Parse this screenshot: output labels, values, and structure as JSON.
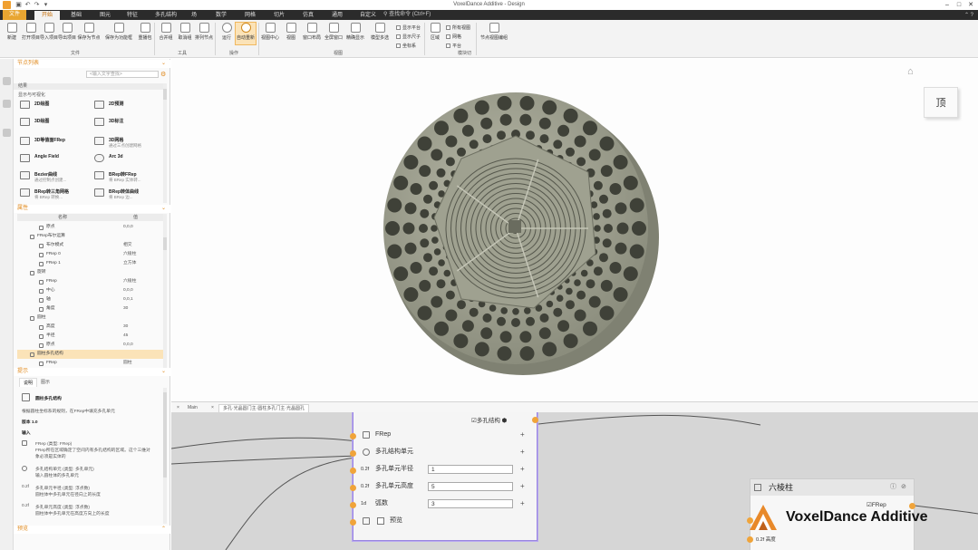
{
  "app": {
    "title": "VoxelDance Additive - Design"
  },
  "menu": {
    "file": "文件",
    "tabs": [
      "开始",
      "基础",
      "图元",
      "特征",
      "多孔结构",
      "场",
      "数学",
      "网格",
      "切片",
      "仿真",
      "通用",
      "自定义"
    ],
    "active_tab": "开始",
    "search_placeholder": "查找命令 (Ctrl+F)"
  },
  "ribbon": {
    "buttons": [
      "新建",
      "打开项目",
      "导入项目",
      "导出项目",
      "保存为节点",
      "保存为功能框",
      "重播包",
      "合并组",
      "取消组",
      "排列节点",
      "运行",
      "自动重新",
      "视图中心",
      "视图",
      "窗口布局",
      "全屏窗口",
      "精确显示",
      "模型多选",
      "区域"
    ],
    "checks": [
      "显示平台",
      "显示尺子",
      "坐标系"
    ],
    "right_checks": [
      "所有视图",
      "网格",
      "平台"
    ],
    "last_button": "节点视图编组",
    "groups": [
      "文件",
      "工具",
      "操作",
      "视图",
      "模块切"
    ]
  },
  "left_panel": {
    "header": "节点列表",
    "search_placeholder": "<输入文字查找>",
    "section_title": "结果",
    "subsection": "显示与可视化",
    "nodes": [
      {
        "name": "2D绘图",
        "desc": ""
      },
      {
        "name": "2D预测",
        "desc": ""
      },
      {
        "name": "3D绘图",
        "desc": ""
      },
      {
        "name": "3D标注",
        "desc": ""
      },
      {
        "name": "3D等值面FRep",
        "desc": ""
      },
      {
        "name": "3D网格",
        "desc": "通过三点创建网格"
      },
      {
        "name": "Angle Field",
        "desc": ""
      },
      {
        "name": "Arc 3d",
        "desc": ""
      },
      {
        "name": "Bezier曲线",
        "desc": "通过控制点创建..."
      },
      {
        "name": "BRep转FRep",
        "desc": "将 BRep 实体转..."
      },
      {
        "name": "BRep转三角网格",
        "desc": "将 BRep 转换..."
      },
      {
        "name": "BRep转体曲线",
        "desc": "将 BRep 边..."
      }
    ]
  },
  "properties": {
    "header": "属性",
    "col_name": "名称",
    "col_value": "值",
    "rows": [
      {
        "name": "原点",
        "value": "0,0,0",
        "indent": 2
      },
      {
        "name": "FRep布尔运算",
        "value": "",
        "indent": 1
      },
      {
        "name": "布尔模式",
        "value": "相交",
        "indent": 2
      },
      {
        "name": "FRep 0",
        "value": "六棱柱",
        "indent": 2
      },
      {
        "name": "FRep 1",
        "value": "立方体",
        "indent": 2
      },
      {
        "name": "旋转",
        "value": "",
        "indent": 1
      },
      {
        "name": "FRep",
        "value": "六棱柱",
        "indent": 2
      },
      {
        "name": "中心",
        "value": "0,0,0",
        "indent": 2
      },
      {
        "name": "轴",
        "value": "0,0,1",
        "indent": 2
      },
      {
        "name": "角度",
        "value": "30",
        "indent": 2
      },
      {
        "name": "圆柱",
        "value": "",
        "indent": 1
      },
      {
        "name": "高度",
        "value": "30",
        "indent": 2
      },
      {
        "name": "半径",
        "value": "45",
        "indent": 2
      },
      {
        "name": "原点",
        "value": "0,0,0",
        "indent": 2
      },
      {
        "name": "圆柱多孔结构",
        "value": "",
        "indent": 1
      },
      {
        "name": "FRep",
        "value": "圆柱",
        "indent": 2
      }
    ]
  },
  "help": {
    "header": "提示",
    "tabs": [
      "说明",
      "图示"
    ],
    "title": "圆柱多孔结构",
    "intro": "根据圆柱坐标系的规则，在FRep中填充多孔单元",
    "version": "版本 1.0",
    "input_label": "输入",
    "items": [
      {
        "title": "FRep (类型: FRep)",
        "line1": "FRep所在区域确定了空间内有多孔结构的区域。这个三维对",
        "line2": "象必须是实体的"
      },
      {
        "title": "多孔结构单元 (类型: 多孔单元)",
        "line1": "输入圆柱体的多孔单元",
        "line2": ""
      },
      {
        "title": "多孔单元半径 (类型: 浮点数)",
        "line1": "圆柱体中多孔单元在径向上的长度",
        "line2": ""
      },
      {
        "title": "多孔单元高度 (类型: 浮点数)",
        "line1": "圆柱体中多孔单元在高度方向上的长度",
        "line2": ""
      }
    ],
    "footer": "预览"
  },
  "viewcube": {
    "face": "顶"
  },
  "node_editor": {
    "tabs": [
      "Main",
      "多孔·光晶圆门主·圆柱多孔门主·光晶圆孔"
    ],
    "node1": {
      "output_label": "多孔结构",
      "rows": [
        {
          "label": "FRep",
          "value": "",
          "type": "frep"
        },
        {
          "label": "多孔结构单元",
          "value": "",
          "type": "cell"
        },
        {
          "label": "多孔单元半径",
          "value": "1",
          "type": "float",
          "prefix": "0.2f"
        },
        {
          "label": "多孔单元高度",
          "value": "5",
          "type": "float",
          "prefix": "0.2f"
        },
        {
          "label": "弧数",
          "value": "3",
          "type": "int",
          "prefix": "1d"
        }
      ],
      "bottom_label": "预览"
    },
    "node2": {
      "title": "六棱柱",
      "output": "FRep",
      "rows": [
        "高度"
      ],
      "prefix": "0.2f"
    }
  },
  "brand": {
    "text": "VoxelDance Additive"
  },
  "colors": {
    "accent": "#e8a531",
    "menu_bg": "#2b2b2b",
    "port": "#f0a43a",
    "selection": "#9a86e0",
    "model_surface": "#a9ab9b"
  }
}
